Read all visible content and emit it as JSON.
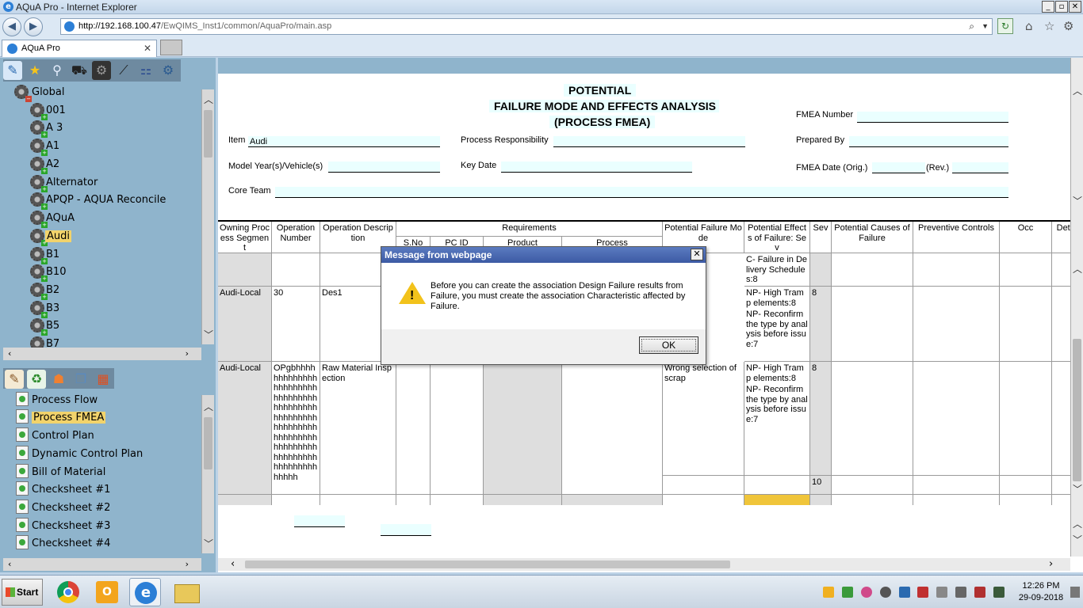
{
  "window": {
    "title": "AQuA Pro - Internet Explorer"
  },
  "address": {
    "url_host": "http://192.168.100.47",
    "url_path": "/EwQIMS_Inst1/common/AquaPro/main.asp"
  },
  "tab": {
    "label": "AQuA Pro"
  },
  "tree": {
    "nodes": [
      "Global",
      "001",
      "A 3",
      "A1",
      "A2",
      "Alternator",
      "APQP - AQUA Reconcile",
      "AQuA",
      "Audi",
      "B1",
      "B10",
      "B2",
      "B3",
      "B5",
      "B7"
    ],
    "selected": "Audi"
  },
  "modules": {
    "items": [
      "Process Flow",
      "Process FMEA",
      "Control Plan",
      "Dynamic Control Plan",
      "Bill of Material",
      "Checksheet #1",
      "Checksheet #2",
      "Checksheet #3",
      "Checksheet #4"
    ],
    "selected": "Process FMEA"
  },
  "header": {
    "title1": "POTENTIAL",
    "title2": "FAILURE MODE AND EFFECTS ANALYSIS",
    "title3": "(PROCESS FMEA)",
    "fmea_number_label": "FMEA Number",
    "item_label": "Item",
    "item_value": "Audi",
    "process_resp_label": "Process Responsibility",
    "prepared_by_label": "Prepared By",
    "model_year_label": "Model Year(s)/Vehicle(s)",
    "key_date_label": "Key Date",
    "fmea_date_label": "FMEA Date (Orig.)",
    "rev_label": "(Rev.)",
    "core_team_label": "Core Team"
  },
  "grid": {
    "columns": {
      "owning": "Owning Process Segment",
      "op_number": "Operation Number",
      "op_desc": "Operation Description",
      "requirements": "Requirements",
      "sno": "S.No",
      "pcid": "PC ID",
      "product": "Product",
      "process": "Process",
      "failure_mode": "Potential Failure Mode",
      "effects": "Potential Effects of Failure: Sev",
      "sev": "Sev",
      "causes": "Potential Causes of Failure",
      "prev": "Preventive Controls",
      "occ": "Occ",
      "detect": "Detec"
    },
    "row0": {
      "effects": "C- Failure in Delivery Schedules:8"
    },
    "row1": {
      "owning": "Audi-Local",
      "op_number": "30",
      "op_desc": "Des1",
      "effect1": "NP- High Tramp elements:8",
      "effect2": "NP- Reconfirm the type by analysis before issue:7",
      "sev": "8"
    },
    "row2": {
      "owning": "Audi-Local",
      "op_number": "OPgbhhhhhhhhhhhhhhhhhhhhhhhhhhhhhhhhhhhhhhhhhhhhhhhhhhhhhhhhhhhhhhhhhhhhhhhhhhhhhhhhhhhhhhhhhhhhhhhhhhh",
      "op_desc": "Raw Material Inspection",
      "failure_mode": "Wrong selection of scrap",
      "effect1": "NP- High Tramp elements:8",
      "effect2": "NP- Reconfirm the type by analysis before issue:7",
      "sev": "8",
      "sev2": "10"
    }
  },
  "dialog": {
    "title": "Message from webpage",
    "message": "Before you can create the association Design Failure results from Failure, you must create the association Characteristic affected by Failure.",
    "ok": "OK"
  },
  "taskbar": {
    "start": "Start",
    "time": "12:26 PM",
    "date": "29-09-2018"
  },
  "colors": {
    "panel": "#8fb4cc",
    "highlight": "#f2d36b",
    "field": "#eaffff",
    "dialog_title": "#3c5aa4"
  }
}
